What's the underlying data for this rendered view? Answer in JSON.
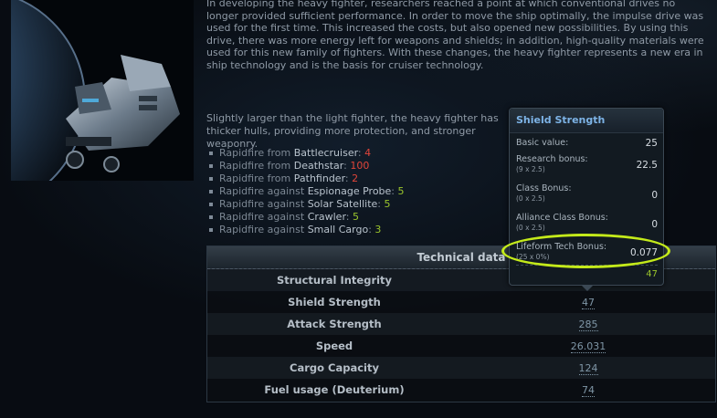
{
  "description": {
    "paragraph1": "In developing the heavy fighter, researchers reached a point at which conventional drives no longer provided sufficient performance. In order to move the ship optimally, the impulse drive was used for the first time. This increased the costs, but also opened new possibilities. By using this drive, there was more energy left for weapons and shields; in addition, high-quality materials were used for this new family of fighters. With these changes, the heavy fighter represents a new era in ship technology and is the basis for cruiser technology.",
    "paragraph2": "Slightly larger than the light fighter, the heavy fighter has thicker hulls, providing more protection, and stronger weaponry."
  },
  "rapidfire": [
    {
      "label": "Rapidfire from",
      "unit": "Battlecruiser",
      "value": "4",
      "color": "#e0453a"
    },
    {
      "label": "Rapidfire from",
      "unit": "Deathstar",
      "value": "100",
      "color": "#e0453a"
    },
    {
      "label": "Rapidfire from",
      "unit": "Pathfinder",
      "value": "2",
      "color": "#e0453a"
    },
    {
      "label": "Rapidfire against",
      "unit": "Espionage Probe",
      "value": "5",
      "color": "#9ac52c"
    },
    {
      "label": "Rapidfire against",
      "unit": "Solar Satellite",
      "value": "5",
      "color": "#9ac52c"
    },
    {
      "label": "Rapidfire against",
      "unit": "Crawler",
      "value": "5",
      "color": "#9ac52c"
    },
    {
      "label": "Rapidfire against",
      "unit": "Small Cargo",
      "value": "3",
      "color": "#9ac52c"
    }
  ],
  "technical_data": {
    "title": "Technical data",
    "rows": [
      {
        "label": "Structural Integrity",
        "value": ""
      },
      {
        "label": "Shield Strength",
        "value": "47"
      },
      {
        "label": "Attack Strength",
        "value": "285"
      },
      {
        "label": "Speed",
        "value": "26.031"
      },
      {
        "label": "Cargo Capacity",
        "value": "124"
      },
      {
        "label": "Fuel usage (Deuterium)",
        "value": "74"
      }
    ]
  },
  "tooltip": {
    "title": "Shield Strength",
    "rows": [
      {
        "label": "Basic value:",
        "formula": "",
        "value": "25"
      },
      {
        "label": "Research bonus:",
        "formula": "(9 x 2.5)",
        "value": "22.5"
      },
      {
        "label": "Class Bonus:",
        "formula": "(0 x 2.5)",
        "value": "0"
      },
      {
        "label": "Alliance Class Bonus:",
        "formula": "(0 x 2.5)",
        "value": "0"
      },
      {
        "label": "Lifeform Tech Bonus:",
        "formula": "(25 x 0%)",
        "value": "0.077"
      }
    ],
    "total": "47"
  },
  "colors": {
    "accent_blue": "#7db3e6",
    "rapidfire_from": "#e0453a",
    "rapidfire_against": "#9ac52c",
    "highlight": "#c4ea1a"
  }
}
